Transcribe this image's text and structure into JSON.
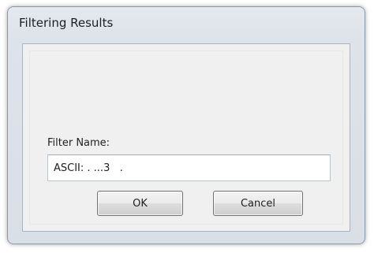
{
  "dialog": {
    "title": "Filtering Results",
    "filter_label": "Filter Name:",
    "filter_value": "ASCII: . ...3   .",
    "ok_label": "OK",
    "cancel_label": "Cancel"
  }
}
